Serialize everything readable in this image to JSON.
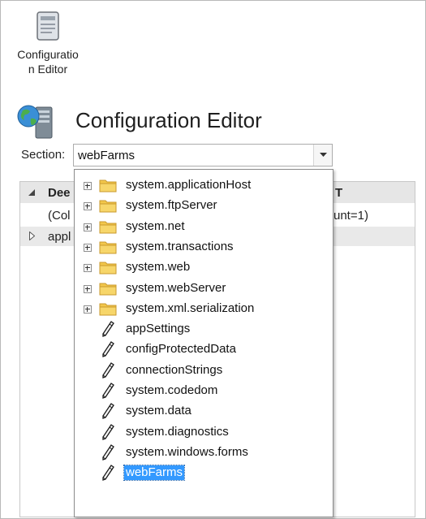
{
  "feature": {
    "label": "Configuratio\nn Editor",
    "icon": "document-icon"
  },
  "header": {
    "title": "Configuration Editor",
    "icon": "server-globe-icon"
  },
  "section": {
    "label": "Section:",
    "value": "webFarms"
  },
  "grid": {
    "header_partial": "Dee",
    "header_right_partial": "T",
    "row1_partial": "(Col",
    "row1_right_partial": "unt=1)",
    "row2_partial": "appl"
  },
  "dropdown": {
    "items": [
      {
        "label": "system.applicationHost",
        "type": "folder",
        "expandable": true
      },
      {
        "label": "system.ftpServer",
        "type": "folder",
        "expandable": true
      },
      {
        "label": "system.net",
        "type": "folder",
        "expandable": true
      },
      {
        "label": "system.transactions",
        "type": "folder",
        "expandable": true
      },
      {
        "label": "system.web",
        "type": "folder",
        "expandable": true
      },
      {
        "label": "system.webServer",
        "type": "folder",
        "expandable": true
      },
      {
        "label": "system.xml.serialization",
        "type": "folder",
        "expandable": true
      },
      {
        "label": "appSettings",
        "type": "section",
        "expandable": false
      },
      {
        "label": "configProtectedData",
        "type": "section",
        "expandable": false
      },
      {
        "label": "connectionStrings",
        "type": "section",
        "expandable": false
      },
      {
        "label": "system.codedom",
        "type": "section",
        "expandable": false
      },
      {
        "label": "system.data",
        "type": "section",
        "expandable": false
      },
      {
        "label": "system.diagnostics",
        "type": "section",
        "expandable": false
      },
      {
        "label": "system.windows.forms",
        "type": "section",
        "expandable": false
      },
      {
        "label": "webFarms",
        "type": "section",
        "expandable": false,
        "selected": true
      }
    ]
  },
  "colors": {
    "selection": "#3399ff",
    "folder": "#f2c74b"
  }
}
